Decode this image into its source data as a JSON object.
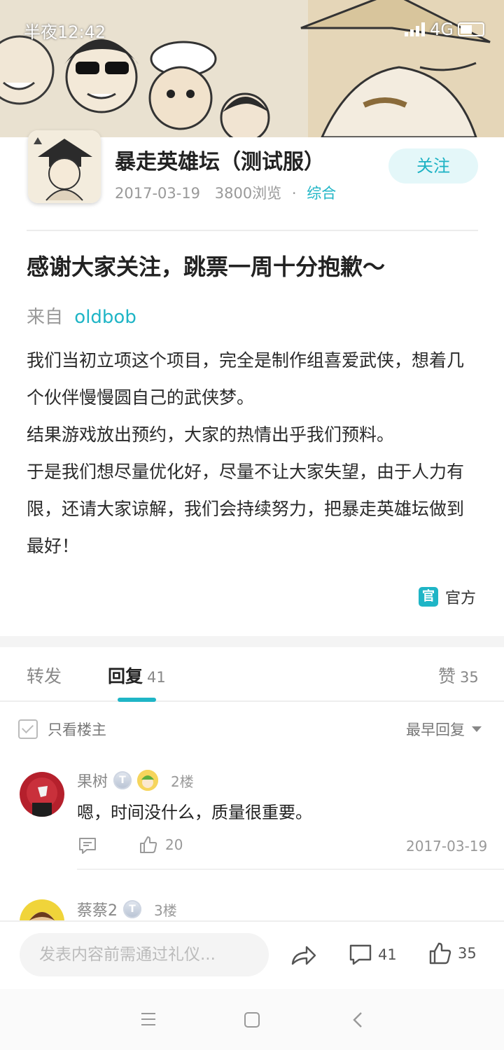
{
  "status_bar": {
    "time": "半夜12:42",
    "network": "4G"
  },
  "forum": {
    "name": "暴走英雄坛（测试服）",
    "date": "2017-03-19",
    "views": "3800浏览",
    "separator": "·",
    "category": "综合",
    "follow_label": "关注"
  },
  "post": {
    "title": "感谢大家关注，跳票一周十分抱歉～",
    "from_label": "来自",
    "author": "oldbob",
    "paragraphs": [
      "我们当初立项这个项目，完全是制作组喜爱武侠，想着几个伙伴慢慢圆自己的武侠梦。",
      "结果游戏放出预约，大家的热情出乎我们预料。",
      "于是我们想尽量优化好，尽量不让大家失望，由于人力有限，还请大家谅解，我们会持续努力，把暴走英雄坛做到最好！"
    ],
    "official_badge": "官",
    "official_label": "官方"
  },
  "tabs": [
    {
      "label": "转发",
      "count": ""
    },
    {
      "label": "回复",
      "count": "41"
    },
    {
      "label": "赞",
      "count": "35"
    }
  ],
  "filter": {
    "only_op_label": "只看楼主",
    "sort_label": "最早回复"
  },
  "replies": [
    {
      "name": "果树",
      "level_badge": "T",
      "floor": "2楼",
      "text": "嗯，时间没什么，质量很重要。",
      "likes": "20",
      "date": "2017-03-19"
    },
    {
      "name": "蔡蔡2",
      "level_badge": "T",
      "floor": "3楼"
    }
  ],
  "bottom_bar": {
    "placeholder": "发表内容前需通过礼仪...",
    "comment_count": "41",
    "like_count": "35"
  },
  "colors": {
    "accent": "#1fb5c6",
    "follow_bg": "#e4f7f9"
  }
}
